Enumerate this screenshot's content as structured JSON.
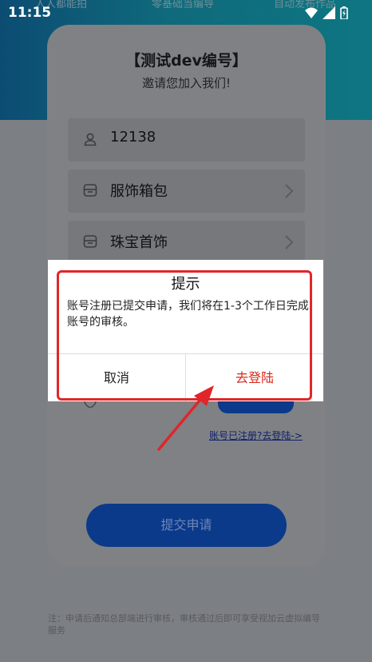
{
  "status_bar": {
    "time": "11:15"
  },
  "header_tabs": [
    "人人都能拍",
    "零基础当编导",
    "自动发布作品"
  ],
  "form": {
    "title": "【测试dev编号】",
    "subtitle": "邀请您加入我们!",
    "fields": [
      {
        "icon": "user-icon",
        "value": "12138"
      },
      {
        "icon": "category-icon",
        "value": "服饰箱包"
      },
      {
        "icon": "category-icon",
        "value": "珠宝首饰"
      }
    ],
    "login_link": "账号已注册?去登陆->",
    "submit_label": "提交申请",
    "note": "注：申请后通知总部端进行审核，审核通过后即可享受视加云虚拟编导服务"
  },
  "dialog": {
    "title": "提示",
    "message": "账号注册已提交申请，我们将在1-3个工作日完成账号的审核。",
    "cancel_label": "取消",
    "confirm_label": "去登陆"
  },
  "colors": {
    "confirm": "#d8281b",
    "annotation": "#e0262a",
    "header": "#0f6a7b"
  }
}
